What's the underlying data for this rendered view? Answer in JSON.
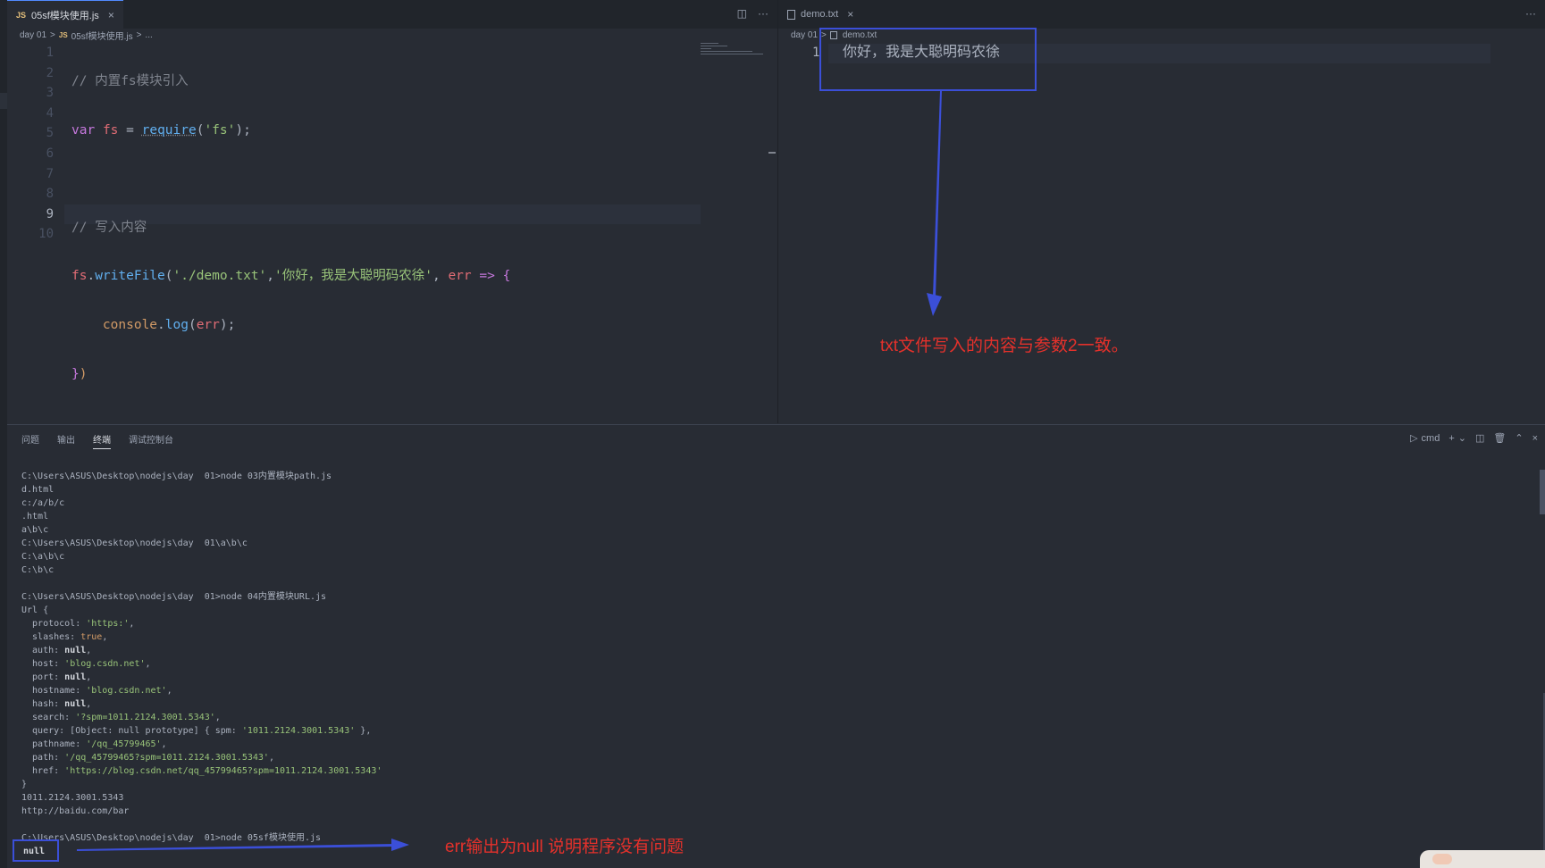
{
  "left_editor": {
    "tab": {
      "badge": "JS",
      "label": "05sf模块使用.js",
      "close": "×"
    },
    "actions": [
      "◫",
      "···"
    ],
    "breadcrumb": [
      "day 01",
      ">",
      "JS",
      "05sf模块使用.js",
      ">",
      "..."
    ],
    "line_numbers": [
      "1",
      "2",
      "3",
      "4",
      "5",
      "6",
      "7",
      "8",
      "9",
      "10"
    ],
    "current_line": "9",
    "code": {
      "line1": "// 内置fs模块引入",
      "line2": {
        "kw": "var",
        "var": "fs",
        "eq": " = ",
        "fn": "require",
        "open": "(",
        "str": "'fs'",
        "close": ");"
      },
      "line4": "// 写入内容",
      "line5": {
        "obj": "fs",
        "dot": ".",
        "fn": "writeFile",
        "open": "(",
        "str1": "'./demo.txt'",
        "comma": ",",
        "str2": "'你好，我是大聪明码农徐'",
        "sep": ", ",
        "param": "err",
        "arrow": " => ",
        "brace": "{"
      },
      "line6": {
        "indent": "    ",
        "obj": "console",
        "dot": ".",
        "fn": "log",
        "open": "(",
        "arg": "err",
        "close": ");"
      },
      "line7": {
        "brace": "}",
        "paren": ")"
      }
    }
  },
  "right_editor": {
    "tab": {
      "label": "demo.txt",
      "close": "×"
    },
    "actions": [
      "···"
    ],
    "breadcrumb": [
      "day 01",
      ">",
      "demo.txt"
    ],
    "line_number": "1",
    "content": "你好，我是大聪明码农徐"
  },
  "annotations": {
    "txt_note": "txt文件写入的内容与参数2一致。",
    "null_note": "err输出为null 说明程序没有问题",
    "color": "#e4312b",
    "box_color": "#3b4fd8"
  },
  "panel": {
    "tabs": [
      "问题",
      "输出",
      "终端",
      "调试控制台"
    ],
    "active_tab": "终端",
    "shell": "cmd",
    "actions": [
      "▷",
      "cmd",
      "+",
      "⌄",
      "◫",
      "🗑",
      "⌃",
      "×"
    ],
    "terminal": {
      "block1": [
        "C:\\Users\\ASUS\\Desktop\\nodejs\\day  01>node 03内置模块path.js",
        "d.html",
        "c:/a/b/c",
        ".html",
        "a\\b\\c",
        "C:\\Users\\ASUS\\Desktop\\nodejs\\day  01\\a\\b\\c",
        "C:\\a\\b\\c",
        "C:\\b\\c"
      ],
      "block2_cmd": "C:\\Users\\ASUS\\Desktop\\nodejs\\day  01>node 04内置模块URL.js",
      "url_open": "Url {",
      "url_fields": [
        {
          "key": "  protocol: ",
          "val": "'https:'",
          "kind": "str"
        },
        {
          "key": "  slashes: ",
          "val": "true",
          "kind": "num"
        },
        {
          "key": "  auth: ",
          "val": "null",
          "kind": "bold"
        },
        {
          "key": "  host: ",
          "val": "'blog.csdn.net'",
          "kind": "str"
        },
        {
          "key": "  port: ",
          "val": "null",
          "kind": "bold"
        },
        {
          "key": "  hostname: ",
          "val": "'blog.csdn.net'",
          "kind": "str"
        },
        {
          "key": "  hash: ",
          "val": "null",
          "kind": "bold"
        },
        {
          "key": "  search: ",
          "val": "'?spm=1011.2124.3001.5343'",
          "kind": "str"
        },
        {
          "key": "  query: [Object: null prototype] { spm: ",
          "val": "'1011.2124.3001.5343'",
          "kind": "str",
          "tail": " }"
        },
        {
          "key": "  pathname: ",
          "val": "'/qq_45799465'",
          "kind": "str"
        },
        {
          "key": "  path: ",
          "val": "'/qq_45799465?spm=1011.2124.3001.5343'",
          "kind": "str"
        },
        {
          "key": "  href: ",
          "val": "'https://blog.csdn.net/qq_45799465?spm=1011.2124.3001.5343'",
          "kind": "str"
        }
      ],
      "url_close": "}",
      "block2_tail": [
        "1011.2124.3001.5343",
        "http://baidu.com/bar"
      ],
      "block3_cmd": "C:\\Users\\ASUS\\Desktop\\nodejs\\day  01>node 05sf模块使用.js",
      "null_output": "null"
    }
  }
}
